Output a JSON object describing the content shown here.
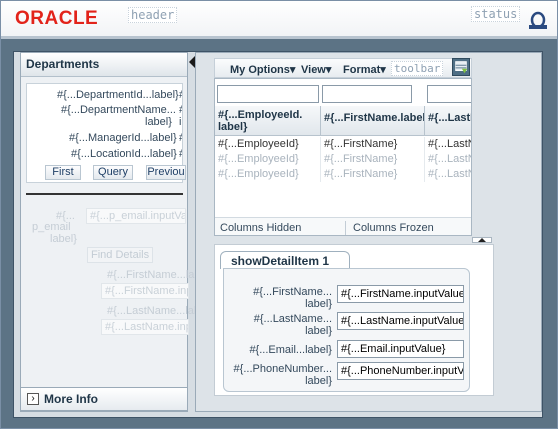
{
  "header": {
    "logo_text": "ORACLE",
    "region_tag": "header",
    "status_tag": "status",
    "status_icon": "loading-status-icon"
  },
  "left_panel": {
    "title": "Departments",
    "form_rows": [
      {
        "label": "#{...DepartmentId...label}",
        "value": "#{."
      },
      {
        "label": "#{...DepartmentName...",
        "label2": "label}",
        "value": "#{.",
        "value2": "inp"
      },
      {
        "label": "#{...ManagerId...label}",
        "value": "#{."
      },
      {
        "label": "#{...LocationId...label}",
        "value": "#{."
      }
    ],
    "nav_buttons": [
      "First",
      "Query",
      "Previou"
    ],
    "faded_search": {
      "label": "#{...",
      "label2": "p_email",
      "label3": "label}",
      "input_value": "#{...p_email.inputValu",
      "button": "Find Details",
      "results": [
        "#{...FirstName...label",
        "#{...FirstName.inpu",
        "#{...LastName...label",
        "#{...LastName.inpu"
      ]
    },
    "more_info": "More Info"
  },
  "toolbar": {
    "menus": [
      "My Options",
      "View",
      "Format"
    ],
    "region_tag": "toolbar",
    "icon": "detach-table-icon"
  },
  "table": {
    "headers": [
      "#{...EmployeeId. label}",
      "#{...FirstName.label}",
      "#{...LastN"
    ],
    "rows": [
      [
        "#{...EmployeeId}",
        "#{...FirstName}",
        "#{...LastN"
      ],
      [
        "#{...EmployeeId}",
        "#{...FirstName}",
        "#{...LastN"
      ],
      [
        "#{...EmployeeId}",
        "#{...FirstName}",
        "#{...LastN"
      ]
    ],
    "footer": {
      "hidden": "Columns Hidden",
      "frozen": "Columns Frozen"
    }
  },
  "detail": {
    "tab_label": "showDetailItem 1",
    "fields": [
      {
        "label": "#{...FirstName...",
        "label2": "label}",
        "value": "#{...FirstName.inputValue"
      },
      {
        "label": "#{...LastName...",
        "label2": "label}",
        "value": "#{...LastName.inputValue"
      },
      {
        "label": "#{...Email...label}",
        "value": "#{...Email.inputValue}"
      },
      {
        "label": "#{...PhoneNumber...",
        "label2": "label}",
        "value": "#{...PhoneNumber.inputV"
      }
    ]
  },
  "colors": {
    "brand_red": "#e2231a",
    "body_bg": "#5c7385",
    "panel_bg": "#d6dde3"
  }
}
